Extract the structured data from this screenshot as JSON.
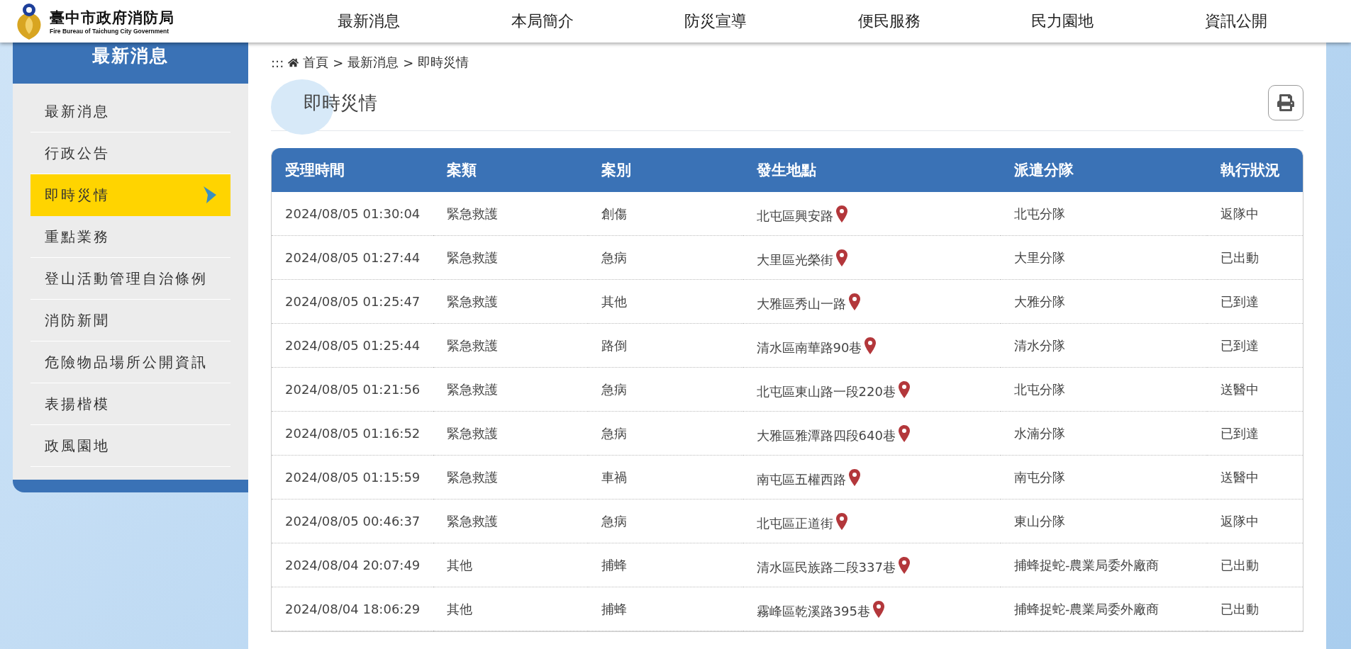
{
  "header": {
    "logo": {
      "title": "臺中市政府消防局",
      "subtitle": "Fire Bureau of Taichung City Government"
    },
    "nav": [
      "最新消息",
      "本局簡介",
      "防災宣導",
      "便民服務",
      "民力園地",
      "資訊公開"
    ]
  },
  "sidebar": {
    "title": "最新消息",
    "items": [
      {
        "label": "最新消息",
        "selected": false
      },
      {
        "label": "行政公告",
        "selected": false
      },
      {
        "label": "即時災情",
        "selected": true
      },
      {
        "label": "重點業務",
        "selected": false
      },
      {
        "label": "登山活動管理自治條例",
        "selected": false
      },
      {
        "label": "消防新聞",
        "selected": false
      },
      {
        "label": "危險物品場所公開資訊",
        "selected": false
      },
      {
        "label": "表揚楷模",
        "selected": false
      },
      {
        "label": "政風園地",
        "selected": false
      }
    ]
  },
  "breadcrumb": {
    "marker": ":::",
    "divider": ">",
    "items": [
      "首頁",
      "最新消息",
      "即時災情"
    ]
  },
  "page_title": "即時災情",
  "table": {
    "columns": [
      "受理時間",
      "案類",
      "案別",
      "發生地點",
      "派遣分隊",
      "執行狀況"
    ],
    "rows": [
      [
        "2024/08/05 01:30:04",
        "緊急救護",
        "創傷",
        "北屯區興安路",
        "北屯分隊",
        "返隊中"
      ],
      [
        "2024/08/05 01:27:44",
        "緊急救護",
        "急病",
        "大里區光榮街",
        "大里分隊",
        "已出動"
      ],
      [
        "2024/08/05 01:25:47",
        "緊急救護",
        "其他",
        "大雅區秀山一路",
        "大雅分隊",
        "已到達"
      ],
      [
        "2024/08/05 01:25:44",
        "緊急救護",
        "路倒",
        "清水區南華路90巷",
        "清水分隊",
        "已到達"
      ],
      [
        "2024/08/05 01:21:56",
        "緊急救護",
        "急病",
        "北屯區東山路一段220巷",
        "北屯分隊",
        "送醫中"
      ],
      [
        "2024/08/05 01:16:52",
        "緊急救護",
        "急病",
        "大雅區雅潭路四段640巷",
        "水湳分隊",
        "已到達"
      ],
      [
        "2024/08/05 01:15:59",
        "緊急救護",
        "車禍",
        "南屯區五權西路",
        "南屯分隊",
        "送醫中"
      ],
      [
        "2024/08/05 00:46:37",
        "緊急救護",
        "急病",
        "北屯區正道街",
        "東山分隊",
        "返隊中"
      ],
      [
        "2024/08/04 20:07:49",
        "其他",
        "捕蜂",
        "清水區民族路二段337巷",
        "捕蜂捉蛇-農業局委外廠商",
        "已出動"
      ],
      [
        "2024/08/04 18:06:29",
        "其他",
        "捕蜂",
        "霧峰區乾溪路395巷",
        "捕蜂捉蛇-農業局委外廠商",
        "已出動"
      ]
    ]
  }
}
